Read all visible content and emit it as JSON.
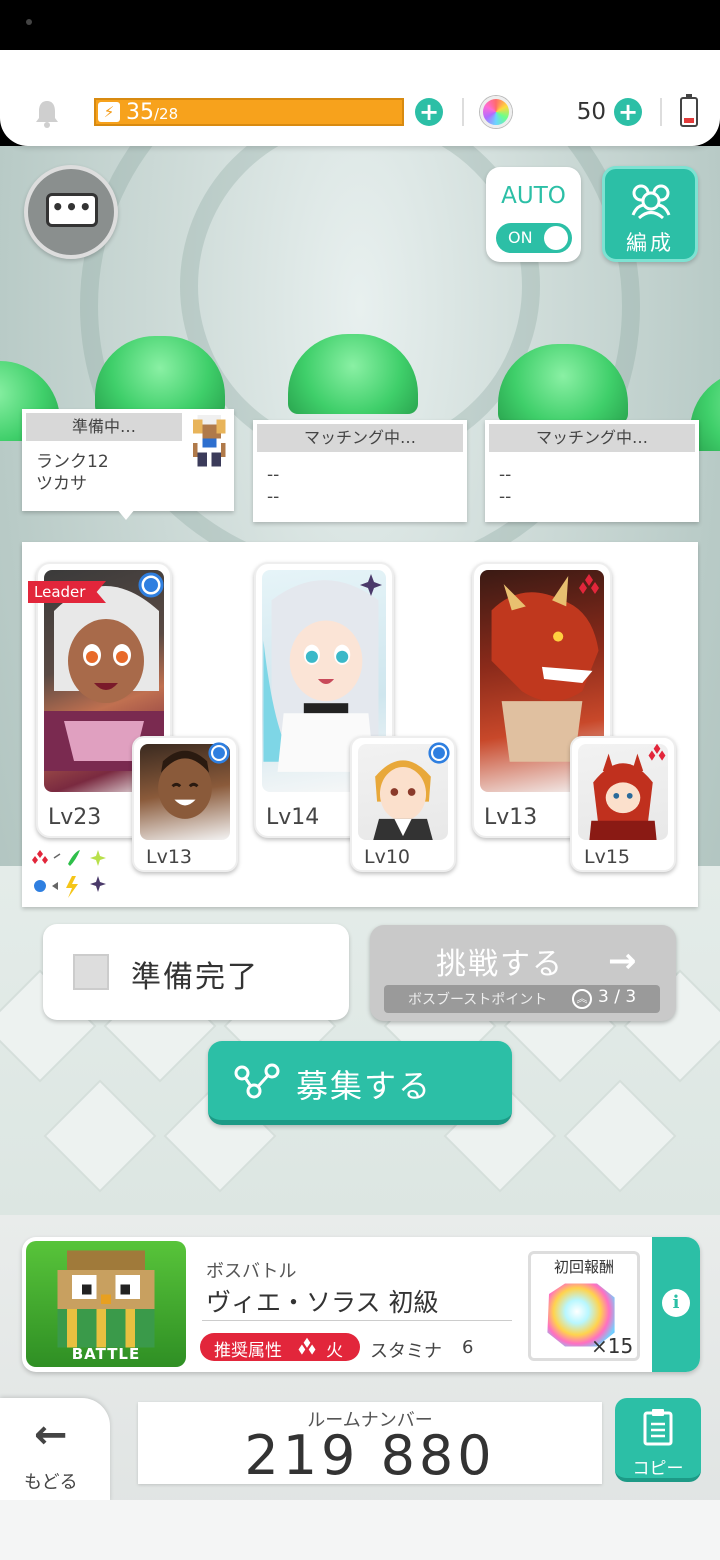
{
  "top_bar": {
    "stamina_current": "35",
    "stamina_max": "/28",
    "gems": "50"
  },
  "auto": {
    "label": "AUTO",
    "toggle": "ON"
  },
  "party_button": {
    "label": "編成"
  },
  "players": [
    {
      "status": "準備中…",
      "line1": "ランク12",
      "line2": "ツカサ"
    },
    {
      "status": "マッチング中…",
      "line1": "--",
      "line2": "--"
    },
    {
      "status": "マッチング中…",
      "line1": "--",
      "line2": "--"
    }
  ],
  "team": {
    "leader_tag": "Leader",
    "units": [
      {
        "main_level": "Lv23",
        "sub_level": "Lv13",
        "main_element": "water",
        "sub_element": "water"
      },
      {
        "main_level": "Lv14",
        "sub_level": "Lv10",
        "main_element": "dark",
        "sub_element": "water"
      },
      {
        "main_level": "Lv13",
        "sub_level": "Lv15",
        "main_element": "fire",
        "sub_element": "fire"
      }
    ],
    "element_legend": [
      "fire",
      "wind",
      "light",
      "water",
      "thunder",
      "dark"
    ]
  },
  "actions": {
    "ready": "準備完了",
    "challenge": "挑戦する",
    "boost_label": "ボスブーストポイント",
    "boost_count": "3 / 3",
    "recruit": "募集する"
  },
  "quest": {
    "thumb_label": "BATTLE",
    "category": "ボスバトル",
    "name": "ヴィエ・ソラス 初級",
    "attr_label": "推奨属性",
    "attr_name": "火",
    "stamina_label": "スタミナ",
    "stamina_cost": "6",
    "reward_label": "初回報酬",
    "reward_count": "×15"
  },
  "footer": {
    "back": "もどる",
    "room_label": "ルームナンバー",
    "room_number": "219 880",
    "copy": "コピー"
  },
  "colors": {
    "accent": "#2cbfa6",
    "stamina": "#f7a21c",
    "fire": "#e2263b",
    "water": "#2f7fe0",
    "dark": "#4a3a6a"
  }
}
